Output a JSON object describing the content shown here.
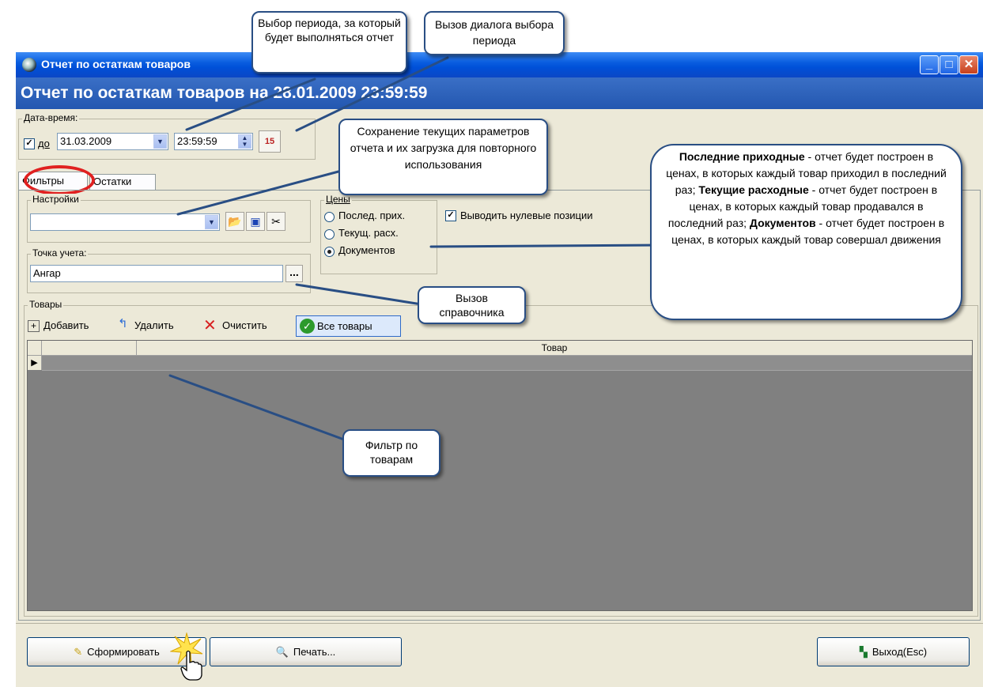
{
  "window": {
    "title": "Отчет по остаткам товаров",
    "header": "Отчет по остаткам товаров на 28.01.2009 23:59:59",
    "controls": {
      "minimize": "_",
      "maximize": "□",
      "close": "✕"
    }
  },
  "datetime": {
    "legend": "Дата-время:",
    "to_checked": true,
    "to_label": "до",
    "date_value": "31.03.2009",
    "time_value": "23:59:59",
    "calendar_icon": "calendar-icon"
  },
  "tabs": [
    {
      "label": "Фильтры",
      "active": true
    },
    {
      "label": "Остатки",
      "active": false
    }
  ],
  "settings": {
    "legend": "Настройки",
    "value": "",
    "buttons": [
      "load-icon",
      "save-icon",
      "cut-icon"
    ]
  },
  "prices": {
    "legend": "Цены",
    "options": [
      {
        "label": "Послед. прих.",
        "selected": false
      },
      {
        "label": "Текущ. расх.",
        "selected": false
      },
      {
        "label": "Документов",
        "selected": true
      }
    ]
  },
  "zero_positions": {
    "label": "Выводить нулевые позиции",
    "checked": true
  },
  "point": {
    "legend": "Точка учета:",
    "value": "Ангар",
    "browse_label": "..."
  },
  "goods": {
    "legend": "Товары",
    "toolbar": {
      "add": "Добавить",
      "remove": "Удалить",
      "clear": "Очистить",
      "all": "Все товары"
    },
    "columns": [
      "",
      "Товар"
    ],
    "current_row_marker": "▶"
  },
  "footer": {
    "generate": "Сформировать",
    "print": "Печать...",
    "exit": "Выход(Esc)"
  },
  "callouts": {
    "period": "Выбор периода, за который будет выполняться отчет",
    "period_dialog": "Вызов диалога выбора периода",
    "save_params": "Сохранение текущих параметров отчета и их загрузка для повторного использования",
    "directory": "Вызов справочника",
    "goods_filter": "Фильтр по товарам",
    "prices_bold1": "Последние приходные",
    "prices_text1": " - отчет будет построен в ценах, в которых каждый товар приходил в последний раз;",
    "prices_bold2": "Текущие расходные",
    "prices_text2": " - отчет будет построен в ценах, в которых каждый товар продавался в последний раз;",
    "prices_bold3": "Документов",
    "prices_text3": " - отчет будет построен в ценах, в которых каждый товар совершал движения"
  },
  "colors": {
    "title_bar": "#0a5ee0",
    "header": "#2f63bd",
    "grid_bg": "#808080",
    "callout_border": "#294e84",
    "highlight": "#e02020"
  }
}
